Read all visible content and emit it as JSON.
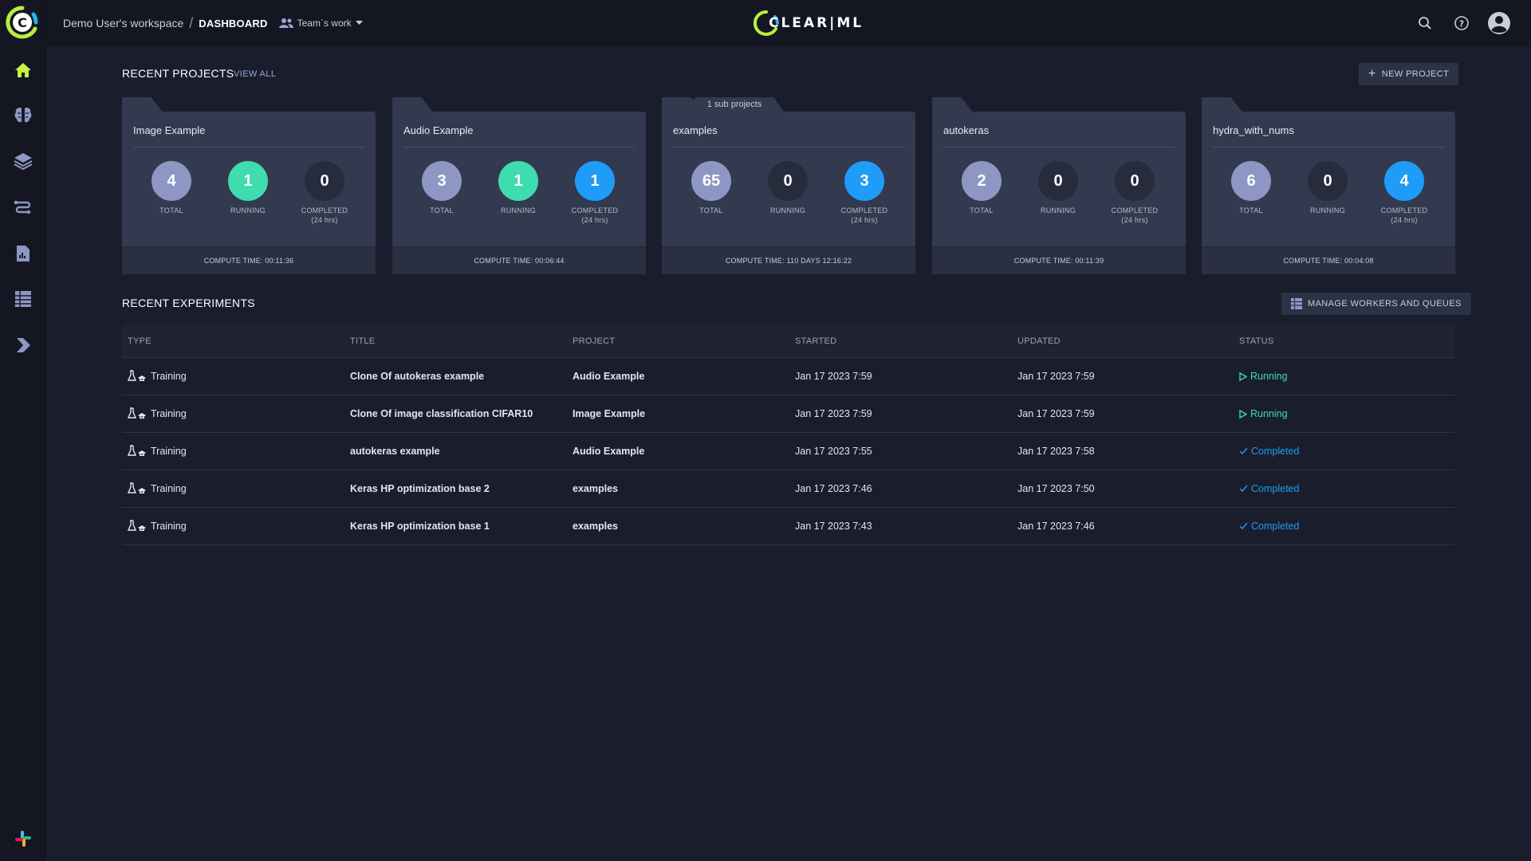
{
  "header": {
    "workspace": "Demo User's workspace",
    "separator": "/",
    "page": "DASHBOARD",
    "team_filter": "Team`s work",
    "brand": "CLEAR|ML"
  },
  "sidebar": {
    "items": [
      {
        "name": "home",
        "icon": "home-icon",
        "active": true
      },
      {
        "name": "projects",
        "icon": "brain-icon"
      },
      {
        "name": "datasets",
        "icon": "layers-icon"
      },
      {
        "name": "pipelines",
        "icon": "pipeline-icon"
      },
      {
        "name": "reports",
        "icon": "report-icon"
      },
      {
        "name": "workers",
        "icon": "workers-queues-icon"
      },
      {
        "name": "applications",
        "icon": "apps-icon"
      }
    ],
    "bottom_icon": "slack-icon"
  },
  "colors": {
    "accent": "#c4f541",
    "running": "#3fdcb0",
    "completed": "#1e9cf7",
    "total": "#8e97c3"
  },
  "recent_projects": {
    "title": "RECENT PROJECTS",
    "view_all": "VIEW ALL",
    "new_project": "NEW PROJECT",
    "labels": {
      "total": "TOTAL",
      "running": "RUNNING",
      "completed": "COMPLETED",
      "completed_sub": "(24 hrs)"
    },
    "cards": [
      {
        "name": "Image Example",
        "sub": "",
        "total": "4",
        "running": "1",
        "completed": "0",
        "compute": "COMPUTE TIME: 00:11:36"
      },
      {
        "name": "Audio Example",
        "sub": "",
        "total": "3",
        "running": "1",
        "completed": "1",
        "compute": "COMPUTE TIME: 00:06:44"
      },
      {
        "name": "examples",
        "sub": "1 sub projects",
        "total": "65",
        "running": "0",
        "completed": "3",
        "compute": "COMPUTE TIME: 110 DAYS 12:16:22"
      },
      {
        "name": "autokeras",
        "sub": "",
        "total": "2",
        "running": "0",
        "completed": "0",
        "compute": "COMPUTE TIME: 00:11:39"
      },
      {
        "name": "hydra_with_nums",
        "sub": "",
        "total": "6",
        "running": "0",
        "completed": "4",
        "compute": "COMPUTE TIME: 00:04:08"
      }
    ]
  },
  "recent_experiments": {
    "title": "RECENT EXPERIMENTS",
    "manage_button": "MANAGE WORKERS AND QUEUES",
    "columns": [
      "TYPE",
      "TITLE",
      "PROJECT",
      "STARTED",
      "UPDATED",
      "STATUS"
    ],
    "rows": [
      {
        "type": "Training",
        "title": "Clone Of autokeras example",
        "project": "Audio Example",
        "started": "Jan 17 2023 7:59",
        "updated": "Jan 17 2023 7:59",
        "status": "Running"
      },
      {
        "type": "Training",
        "title": "Clone Of image classification CIFAR10",
        "project": "Image Example",
        "started": "Jan 17 2023 7:59",
        "updated": "Jan 17 2023 7:59",
        "status": "Running"
      },
      {
        "type": "Training",
        "title": "autokeras example",
        "project": "Audio Example",
        "started": "Jan 17 2023 7:55",
        "updated": "Jan 17 2023 7:58",
        "status": "Completed"
      },
      {
        "type": "Training",
        "title": "Keras HP optimization base 2",
        "project": "examples",
        "started": "Jan 17 2023 7:46",
        "updated": "Jan 17 2023 7:50",
        "status": "Completed"
      },
      {
        "type": "Training",
        "title": "Keras HP optimization base 1",
        "project": "examples",
        "started": "Jan 17 2023 7:43",
        "updated": "Jan 17 2023 7:46",
        "status": "Completed"
      }
    ]
  }
}
